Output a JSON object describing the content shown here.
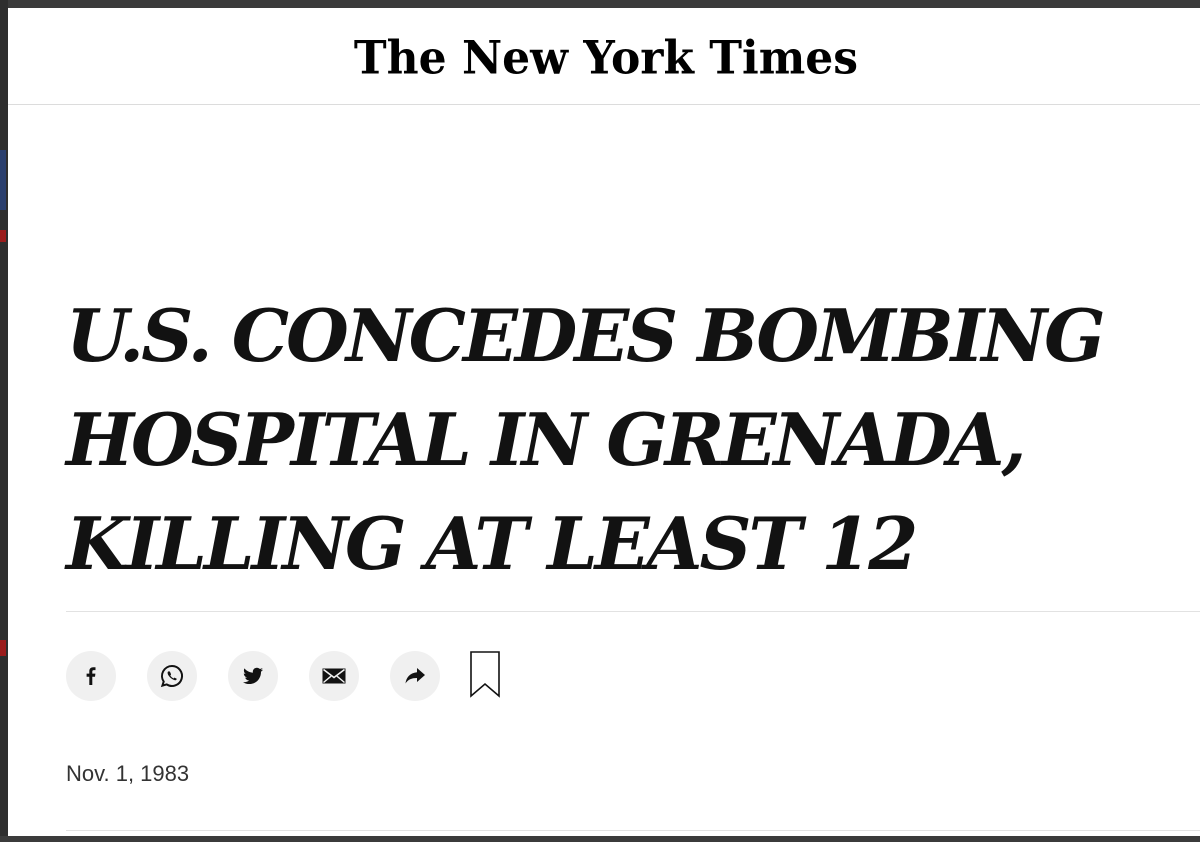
{
  "masthead": {
    "logo_text": "The New York Times"
  },
  "article": {
    "headline": "U.S. CONCEDES BOMBING\nHOSPITAL IN GRENADA,\nKILLING AT LEAST 12",
    "date": "Nov. 1, 1983"
  },
  "share_bar": {
    "buttons": [
      {
        "name": "facebook",
        "icon": "facebook-icon"
      },
      {
        "name": "whatsapp",
        "icon": "whatsapp-icon"
      },
      {
        "name": "twitter",
        "icon": "twitter-icon"
      },
      {
        "name": "email",
        "icon": "email-icon"
      },
      {
        "name": "share",
        "icon": "share-arrow-icon"
      }
    ],
    "save_icon": "bookmark-icon"
  },
  "colors": {
    "text": "#121212",
    "button_bg": "#f0f0f0",
    "divider": "#e2e2e2",
    "frame": "#3b3b3b"
  }
}
